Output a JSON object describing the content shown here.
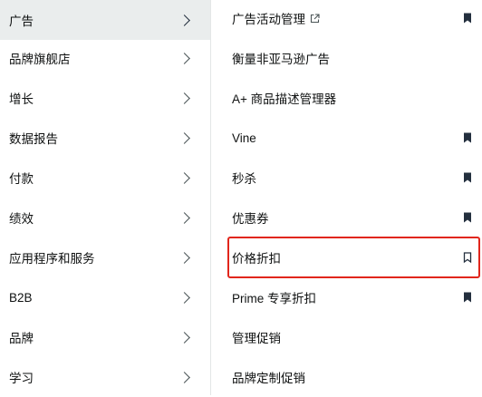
{
  "left_menu": {
    "items": [
      {
        "label": "广告"
      },
      {
        "label": "品牌旗舰店"
      },
      {
        "label": "增长"
      },
      {
        "label": "数据报告"
      },
      {
        "label": "付款"
      },
      {
        "label": "绩效"
      },
      {
        "label": "应用程序和服务"
      },
      {
        "label": "B2B"
      },
      {
        "label": "品牌"
      },
      {
        "label": "学习"
      }
    ],
    "active_item": "广告"
  },
  "right_menu": {
    "items": [
      {
        "label": "广告活动管理",
        "external_icon": true,
        "bookmark": "filled"
      },
      {
        "label": "衡量非亚马逊广告",
        "bookmark": "none"
      },
      {
        "label": "A+ 商品描述管理器",
        "bookmark": "none"
      },
      {
        "label": "Vine",
        "bookmark": "filled"
      },
      {
        "label": "秒杀",
        "bookmark": "filled"
      },
      {
        "label": "优惠券",
        "bookmark": "filled"
      },
      {
        "label": "价格折扣",
        "bookmark": "outline",
        "highlighted": true
      },
      {
        "label": "Prime 专享折扣",
        "bookmark": "filled"
      },
      {
        "label": "管理促销",
        "bookmark": "none"
      },
      {
        "label": "品牌定制促销",
        "bookmark": "none"
      }
    ]
  },
  "colors": {
    "active_bg": "#eaeded",
    "highlight_border": "#e1261c",
    "icon": "#232f3e"
  }
}
